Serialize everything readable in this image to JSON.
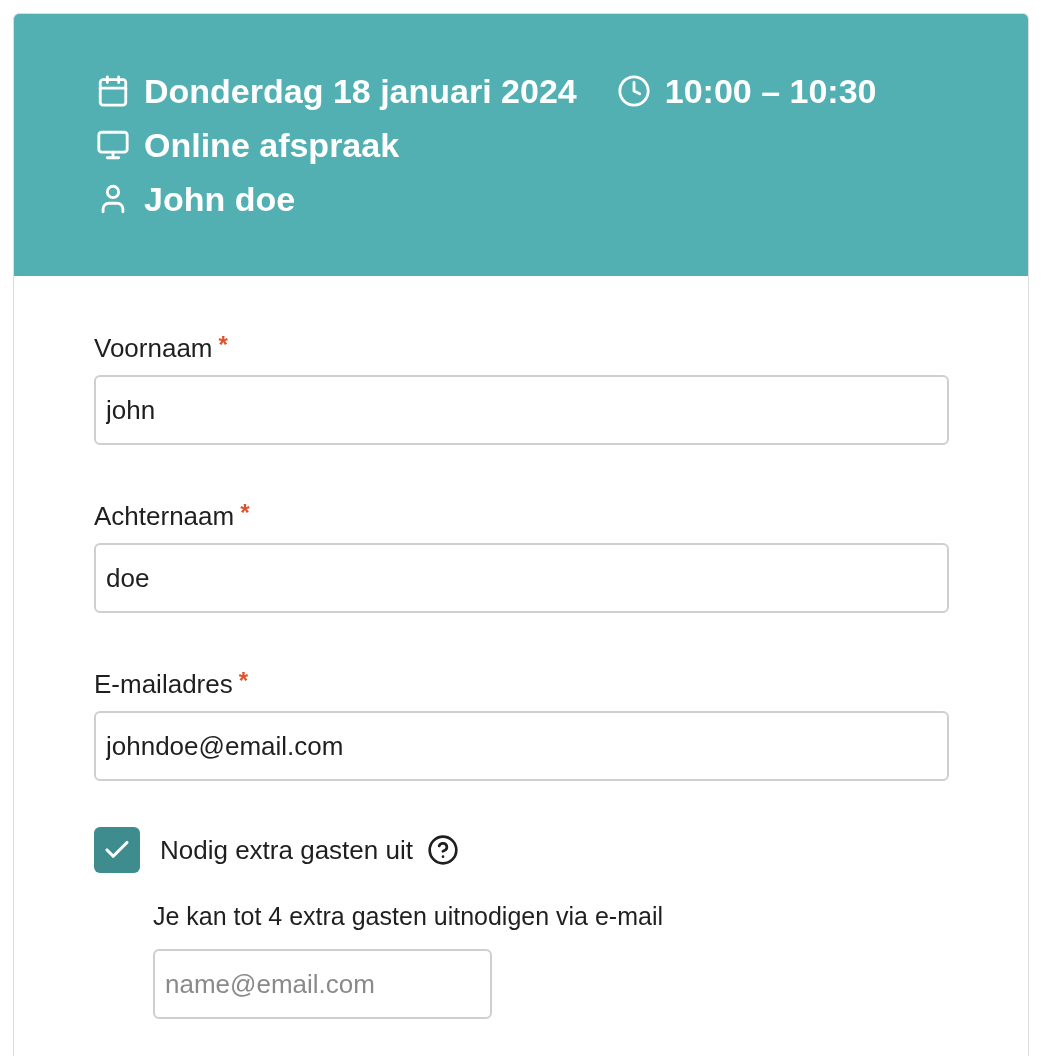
{
  "header": {
    "rows": [
      [
        {
          "kind": "calendar",
          "text": "Donderdag 18 januari 2024"
        },
        {
          "kind": "clock",
          "text": "10:00 – 10:30"
        }
      ],
      [
        {
          "kind": "monitor",
          "text": "Online afspraak"
        }
      ],
      [
        {
          "kind": "person",
          "text": "John doe"
        }
      ]
    ]
  },
  "fields": [
    {
      "label": "Voornaam",
      "required_mark": "*",
      "value": "john"
    },
    {
      "label": "Achternaam",
      "required_mark": "*",
      "value": "doe"
    },
    {
      "label": "E-mailadres",
      "required_mark": "*",
      "value": "johndoe@email.com"
    }
  ],
  "guests": {
    "label": "Nodig extra gasten uit",
    "checked": true,
    "hint": "Je kan tot 4 extra gasten uitnodigen via e-mail",
    "placeholder": "name@email.com"
  }
}
